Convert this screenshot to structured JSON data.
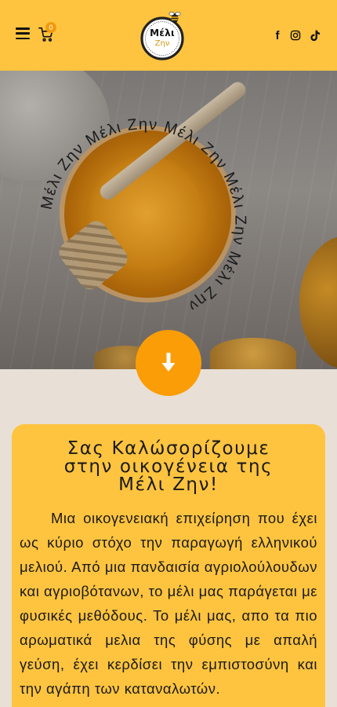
{
  "header": {
    "cart_count": "0",
    "logo": {
      "line1": "Μέλι",
      "line2": "Ζην"
    },
    "social": [
      "facebook-icon",
      "instagram-icon",
      "tiktok-icon"
    ]
  },
  "hero": {
    "circle_text": "Μέλι Ζην Μέλι Ζην Μέλι Ζην Μέλι Ζην Μέλι Ζην "
  },
  "welcome": {
    "title_lines": [
      "Σας Καλώσορίζουμε",
      "στην οικογένεια της",
      "Μέλι Ζην!"
    ],
    "body": "Μια οικογενειακή επιχείρηση που έχει ως κύριο στόχο την παραγωγή ελληνικού μελιού. Από μια πανδαισία αγριολούλουδων και αγριοβότανων, το μέλι μας παράγεται  με φυσικές μεθόδους. Το μέλι μας, απο τα πιο αρωματικά μελια της φύσης με απαλή γεύση, έχει κερδίσει την εμπιστοσύνη και την αγάπη των καταναλωτών."
  },
  "colors": {
    "header_bg": "#fec43f",
    "accent_orange": "#fb9d07",
    "page_bg": "#e8e0d6"
  }
}
